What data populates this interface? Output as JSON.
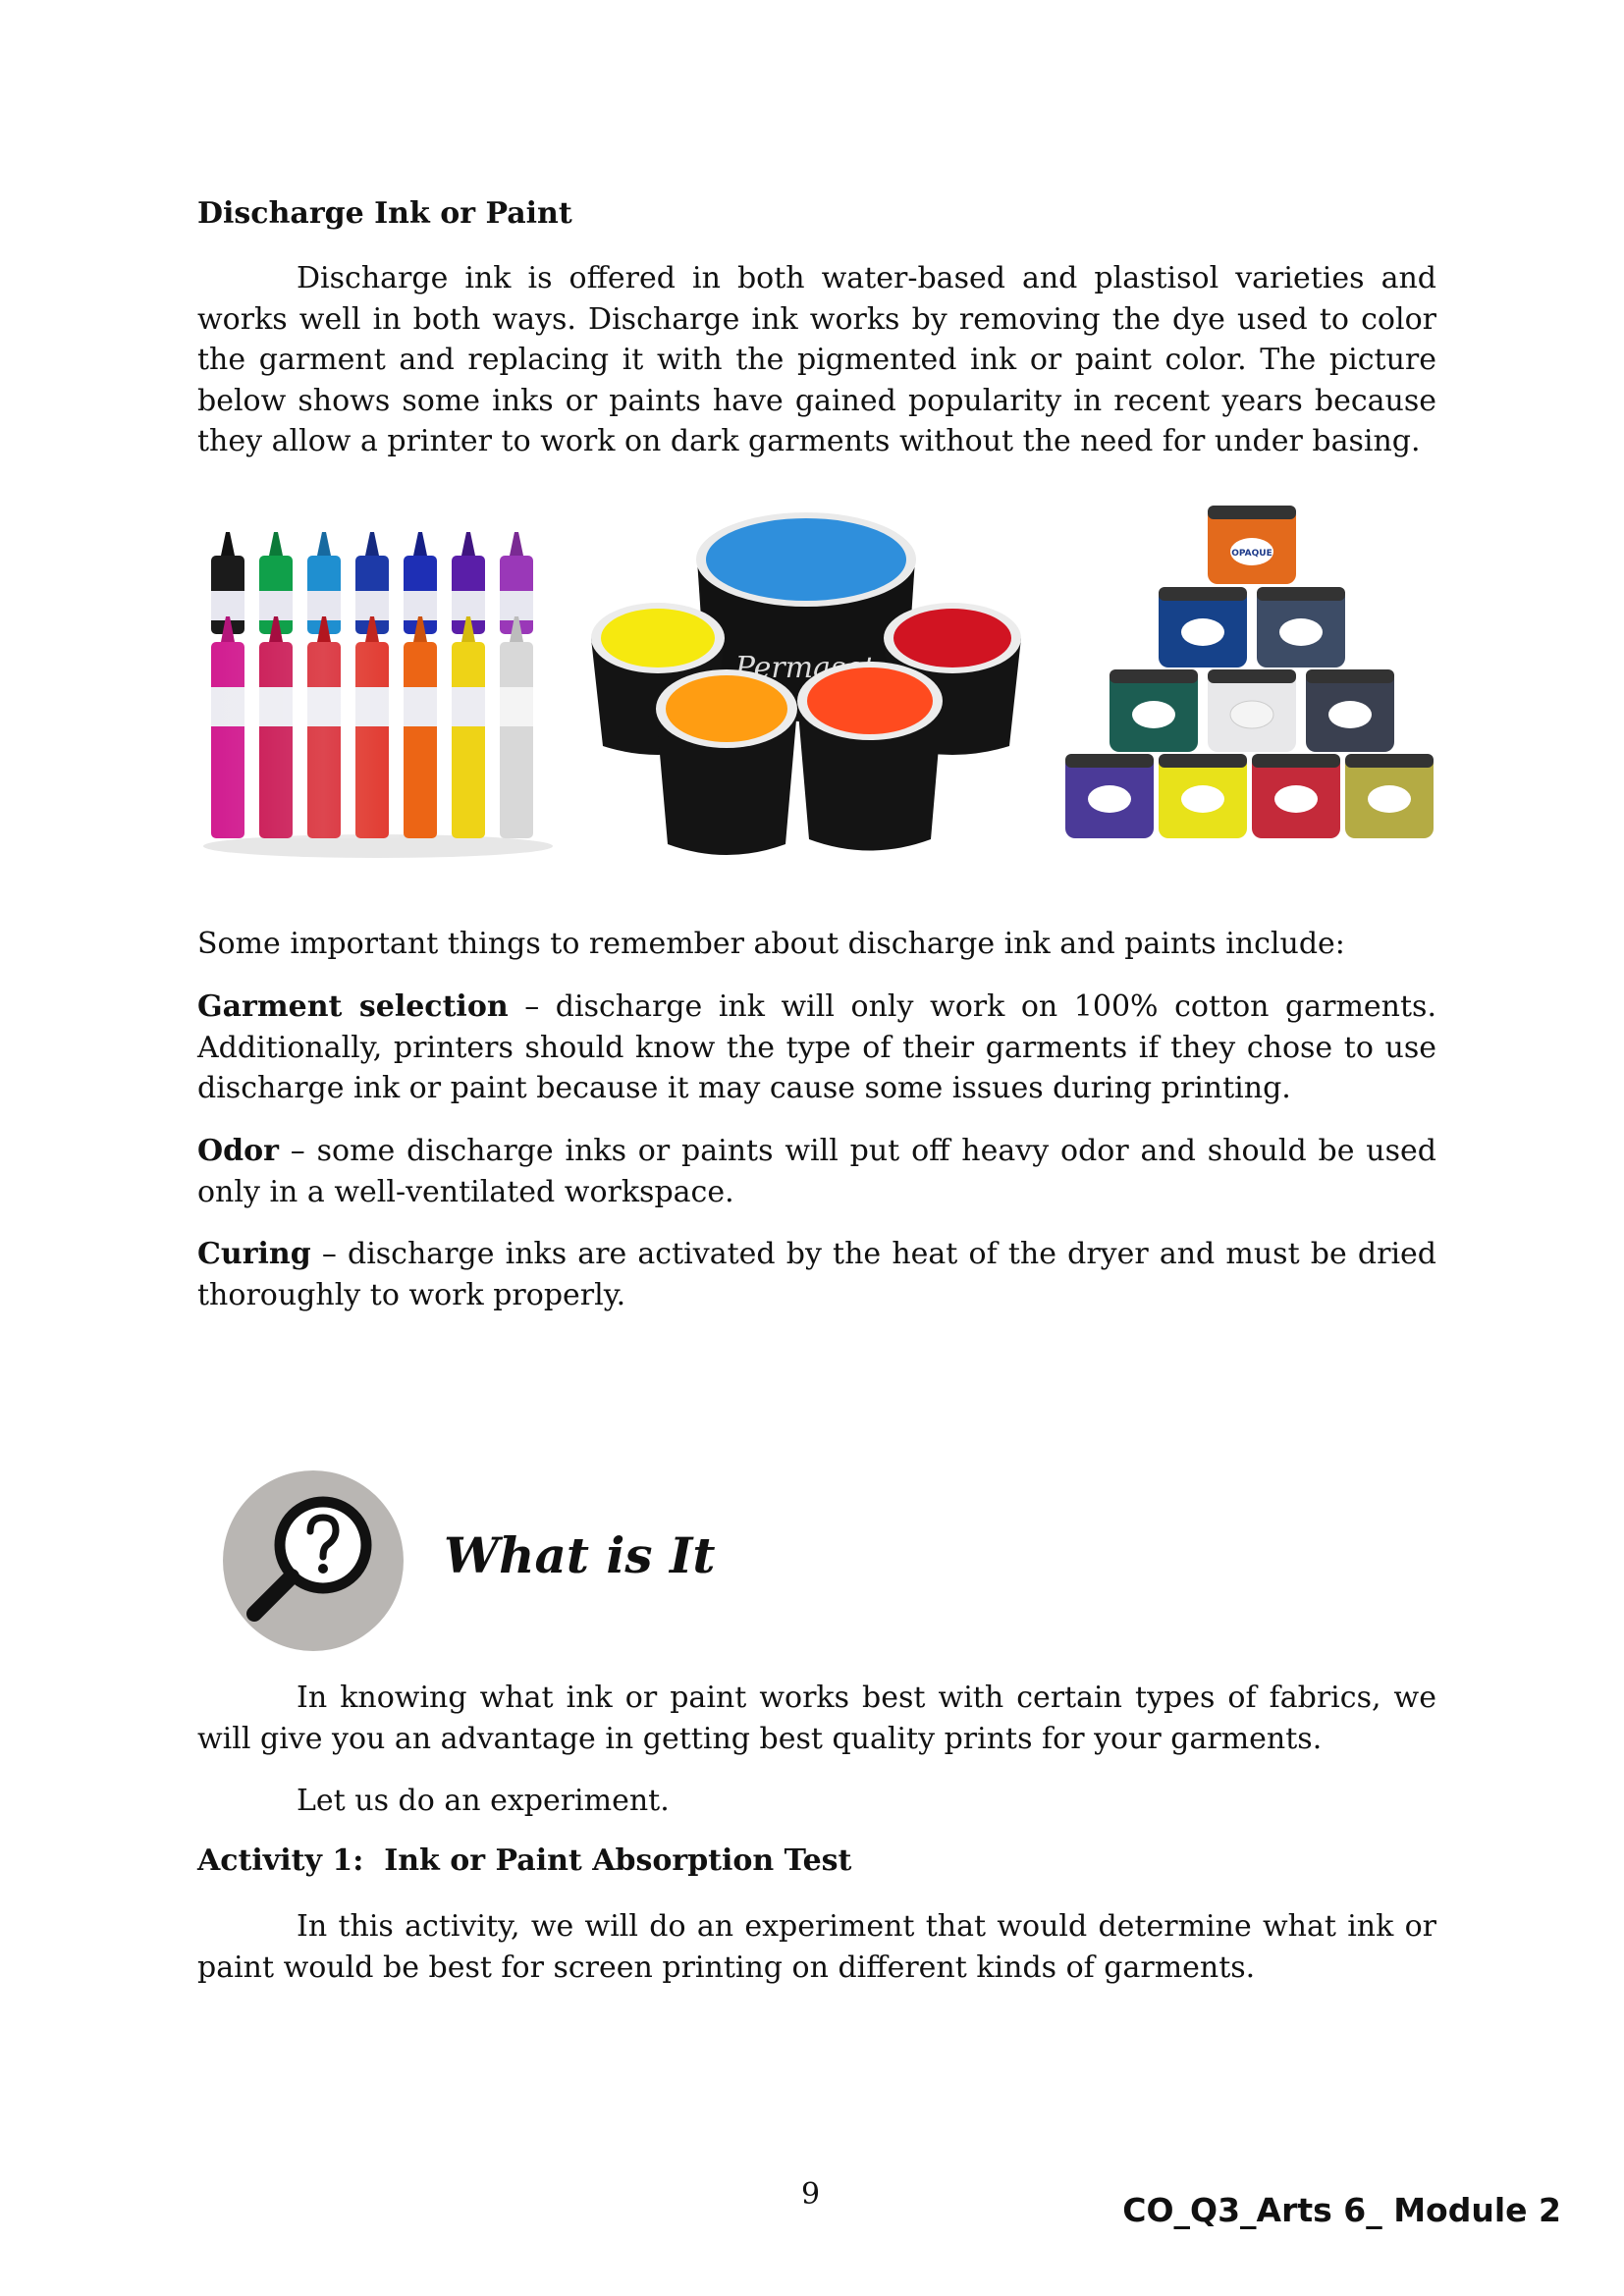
{
  "discharge": {
    "heading": "Discharge Ink or Paint",
    "paragraph": "Discharge ink is offered in both water-based and plastisol varieties and works well in both ways. Discharge ink works by removing the dye used to color the garment and replacing it with the pigmented ink or paint color. The picture below shows some inks or paints have gained popularity in recent years because they allow a printer to work on dark garments without the need for under basing."
  },
  "images": {
    "bucket_brand": "Permaset",
    "jar_brand": "OPAQUE"
  },
  "remember": {
    "intro": "Some important things to remember about discharge ink and paints include:",
    "items": [
      {
        "term": "Garment selection",
        "text": " – discharge ink will only work on 100% cotton garments. Additionally, printers should know the type of their garments if they chose to use discharge ink or paint because it may cause some issues during printing."
      },
      {
        "term": "Odor",
        "text": " – some discharge inks or paints will put off heavy odor and should be used only in a well-ventilated workspace."
      },
      {
        "term": "Curing",
        "text": " – discharge inks are activated by the heat of the dryer and must be dried thoroughly to work properly."
      }
    ]
  },
  "what_is_it": {
    "title": "What is It",
    "paragraph1": "In knowing what ink or paint works best with certain types of fabrics, we will give you an advantage in getting best quality prints for your garments.",
    "paragraph2": "Let us do an experiment.",
    "activity_heading": "Activity 1:  Ink or Paint Absorption Test",
    "activity_paragraph": "In this activity, we will do an experiment that would determine what ink or paint would be best for screen printing on different kinds of garments."
  },
  "footer": {
    "page_number": "9",
    "module_code": "CO_Q3_Arts 6_ Module 2"
  },
  "colors": {
    "icon_circle": "#b9b6b3",
    "bucket_blue": "#2f8fdc",
    "bucket_yellow": "#f6e90f",
    "bucket_orange": "#ff9d12",
    "bucket_redorange": "#ff4b1f",
    "bucket_red": "#d11422"
  }
}
